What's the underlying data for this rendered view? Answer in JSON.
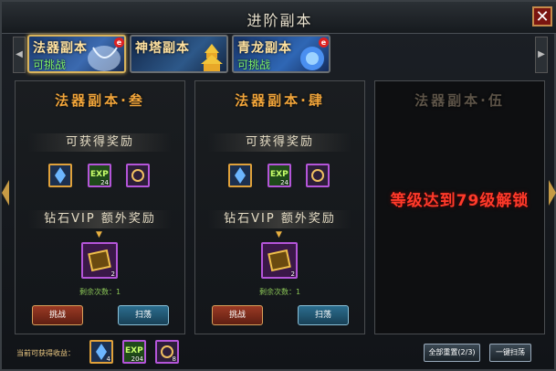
{
  "window": {
    "title": "进阶副本"
  },
  "tabs": [
    {
      "name": "法器副本",
      "state": "可挑战",
      "badge": "e"
    },
    {
      "name": "神塔副本",
      "state": "",
      "badge": ""
    },
    {
      "name": "青龙副本",
      "state": "可挑战",
      "badge": "e"
    }
  ],
  "panels": [
    {
      "title": "法器副本·叁",
      "rewards_label": "可获得奖励",
      "vip_label": "钻石VIP  额外奖励",
      "vip_item_count": "2",
      "remaining": "剩余次数：1",
      "challenge_label": "挑战",
      "sweep_label": "扫荡",
      "reward_counts": [
        "",
        "24",
        ""
      ]
    },
    {
      "title": "法器副本·肆",
      "rewards_label": "可获得奖励",
      "vip_label": "钻石VIP  额外奖励",
      "vip_item_count": "2",
      "remaining": "剩余次数：1",
      "challenge_label": "挑战",
      "sweep_label": "扫荡",
      "reward_counts": [
        "",
        "24",
        ""
      ]
    },
    {
      "title": "法器副本·伍",
      "locked_message": "等级达到79级解锁"
    }
  ],
  "footer": {
    "label": "当前可获得收益：",
    "item_counts": [
      "4",
      "204",
      "8"
    ],
    "reset_label": "全部重置",
    "reset_count": "(2/3)",
    "sweep_all_label": "一键扫荡"
  },
  "colors": {
    "accent": "#f0a43a",
    "lock": "#ff3a2a",
    "ok": "#7df06a"
  }
}
